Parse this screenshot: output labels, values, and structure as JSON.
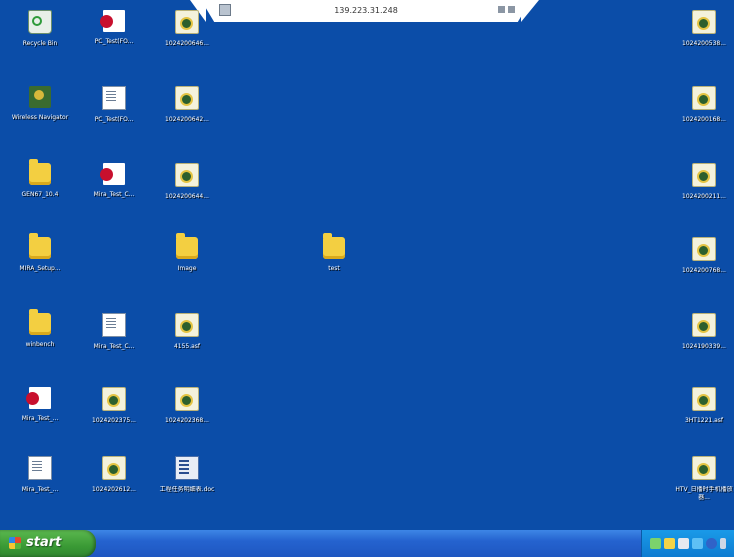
{
  "remote_bar": {
    "host": "139.223.31.248"
  },
  "icons": [
    {
      "label": "Recycle Bin",
      "kind": "recycle"
    },
    {
      "label": "PC_Test(FO...",
      "kind": "pdf"
    },
    {
      "label": "1024200646...",
      "kind": "media"
    },
    {
      "label": "Wireless Navigator",
      "kind": "nav"
    },
    {
      "label": "PC_Test(FO...",
      "kind": "doc"
    },
    {
      "label": "1024200642...",
      "kind": "media"
    },
    {
      "label": "GEN67_10.4",
      "kind": "folder"
    },
    {
      "label": "Mira_Test_C...",
      "kind": "pdf"
    },
    {
      "label": "1024200644...",
      "kind": "media"
    },
    {
      "label": "MIRA_Setup...",
      "kind": "folder"
    },
    {
      "label": "Image",
      "kind": "folder"
    },
    {
      "label": "test",
      "kind": "folder"
    },
    {
      "label": "winbench",
      "kind": "folder"
    },
    {
      "label": "Mira_Test_C...",
      "kind": "doc"
    },
    {
      "label": "4155.asf",
      "kind": "media"
    },
    {
      "label": "Mira_Test_...",
      "kind": "pdf"
    },
    {
      "label": "1024202375...",
      "kind": "media"
    },
    {
      "label": "1024202368...",
      "kind": "media"
    },
    {
      "label": "Mira_Test_...",
      "kind": "doc"
    },
    {
      "label": "1024202612...",
      "kind": "media"
    },
    {
      "label": "工程任务明细表.doc",
      "kind": "cdoc"
    },
    {
      "label": "1024200538...",
      "kind": "media"
    },
    {
      "label": "1024200168...",
      "kind": "media"
    },
    {
      "label": "1024200211...",
      "kind": "media"
    },
    {
      "label": "1024200768...",
      "kind": "media"
    },
    {
      "label": "1024190339...",
      "kind": "media"
    },
    {
      "label": "3HT1221.asf",
      "kind": "media"
    },
    {
      "label": "HTV_日播时手机播放器...",
      "kind": "media"
    }
  ],
  "taskbar": {
    "start_label": "start"
  },
  "colors": {
    "desktop": "#0b4da8",
    "taskbar": "#2563cf",
    "start": "#3a9a35",
    "tray": "#0e7cd1"
  }
}
